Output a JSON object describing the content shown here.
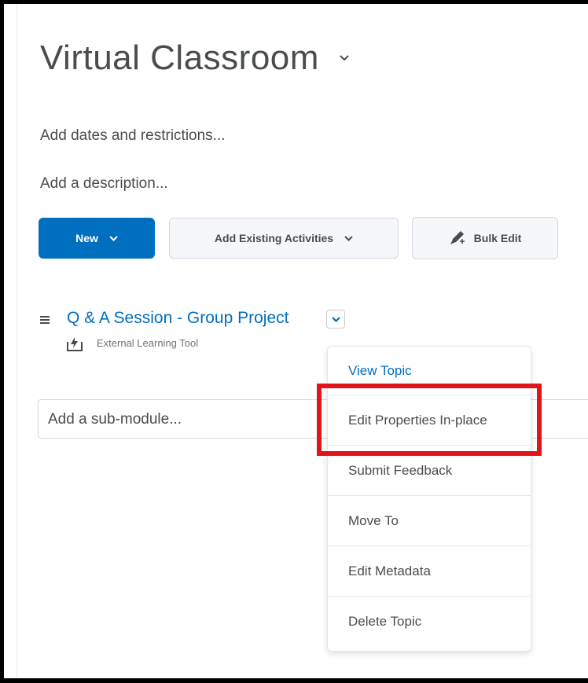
{
  "page": {
    "title": "Virtual Classroom",
    "add_dates": "Add dates and restrictions...",
    "add_description": "Add a description..."
  },
  "toolbar": {
    "new_label": "New",
    "add_existing_label": "Add Existing Activities",
    "bulk_edit_label": "Bulk Edit"
  },
  "topic": {
    "title": "Q & A Session - Group Project",
    "type_label": "External Learning Tool"
  },
  "submodule": {
    "placeholder": "Add a sub-module..."
  },
  "context_menu": {
    "items": [
      {
        "label": "View Topic"
      },
      {
        "label": "Edit Properties In-place"
      },
      {
        "label": "Submit Feedback"
      },
      {
        "label": "Move To"
      },
      {
        "label": "Edit Metadata"
      },
      {
        "label": "Delete Topic"
      }
    ]
  },
  "colors": {
    "primary": "#006fbf",
    "text": "#494c4e",
    "highlight": "#e1141a"
  },
  "icons": {
    "title_chevron": "chevron-down-icon",
    "new_caret": "chevron-down-icon",
    "add_existing_caret": "chevron-down-icon",
    "bulk_edit": "pencil-icon",
    "drag_handle": "drag-handle-icon",
    "topic_context": "chevron-down-icon",
    "external_tool": "external-tool-icon"
  }
}
